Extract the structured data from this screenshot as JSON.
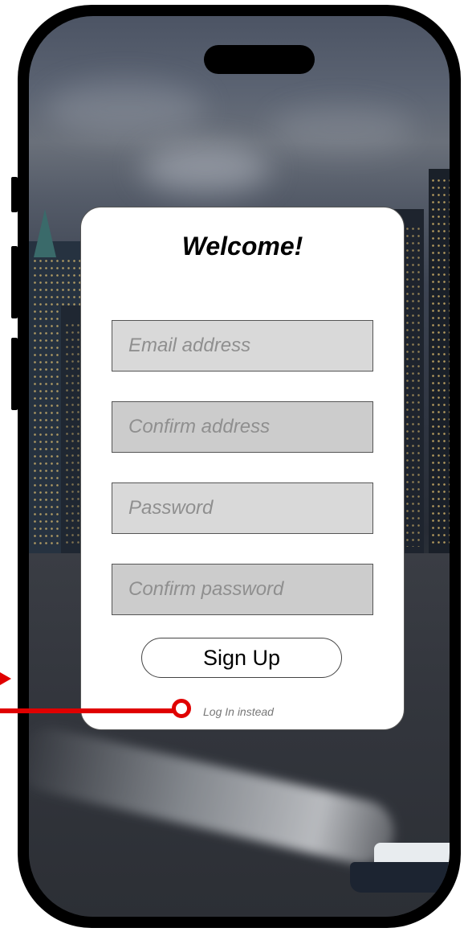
{
  "card": {
    "title": "Welcome!",
    "fields": [
      {
        "placeholder": "Email address"
      },
      {
        "placeholder": "Confirm address"
      },
      {
        "placeholder": "Password"
      },
      {
        "placeholder": "Confirm password"
      }
    ],
    "signup_label": "Sign Up",
    "login_link_label": "Log In instead"
  },
  "background": {
    "description_icon": "city-skyline-at-dusk-image"
  },
  "colors": {
    "annotation": "#e00000",
    "field_light": "#d9d9d9",
    "field_dark": "#cccccc"
  }
}
